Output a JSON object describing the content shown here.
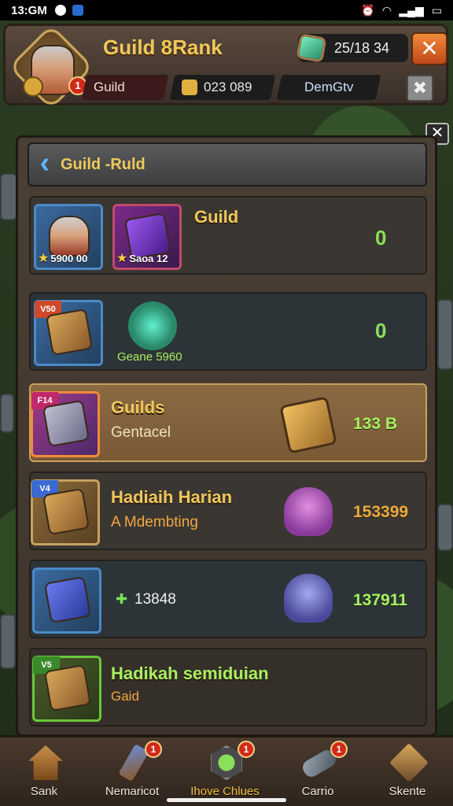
{
  "status_bar": {
    "time": "13:GM"
  },
  "header": {
    "title": "Guild 8Rank",
    "avatar_badge": "1",
    "currency": "25/18 34",
    "guild_tab": "Guild",
    "gold_amount": "023 089",
    "dem_tab": "DemGtv"
  },
  "panel": {
    "title": "Guild -Ruld",
    "rows": [
      {
        "icon1_caption": "5900 00",
        "icon2_caption": "Saoa 12",
        "title": "Guild",
        "value": "0"
      },
      {
        "tag": "V50",
        "subtitle": "Geane 5960",
        "value": "0"
      },
      {
        "tag": "F14",
        "title": "Guilds",
        "subtitle": "Gentacel",
        "value": "133 B"
      },
      {
        "tag": "V4",
        "title": "Hadiaih Harian",
        "subtitle": "A Mdembting",
        "value": "153399"
      },
      {
        "subtitle": "13848",
        "value": "137911"
      },
      {
        "tag": "V5",
        "title": "Hadikah semiduian",
        "subtitle": "Gaid"
      }
    ]
  },
  "bottom_nav": {
    "items": [
      {
        "label": "Sank",
        "badge": ""
      },
      {
        "label": "Nemaricot",
        "badge": "1"
      },
      {
        "label": "Ihove Chlues",
        "badge": "1"
      },
      {
        "label": "Carrio",
        "badge": "1"
      },
      {
        "label": "Skente",
        "badge": ""
      }
    ]
  },
  "colors": {
    "accent_gold": "#f0c85a",
    "value_green": "#a8f060",
    "badge_red": "#d12a1a",
    "close_orange": "#e0682a"
  }
}
